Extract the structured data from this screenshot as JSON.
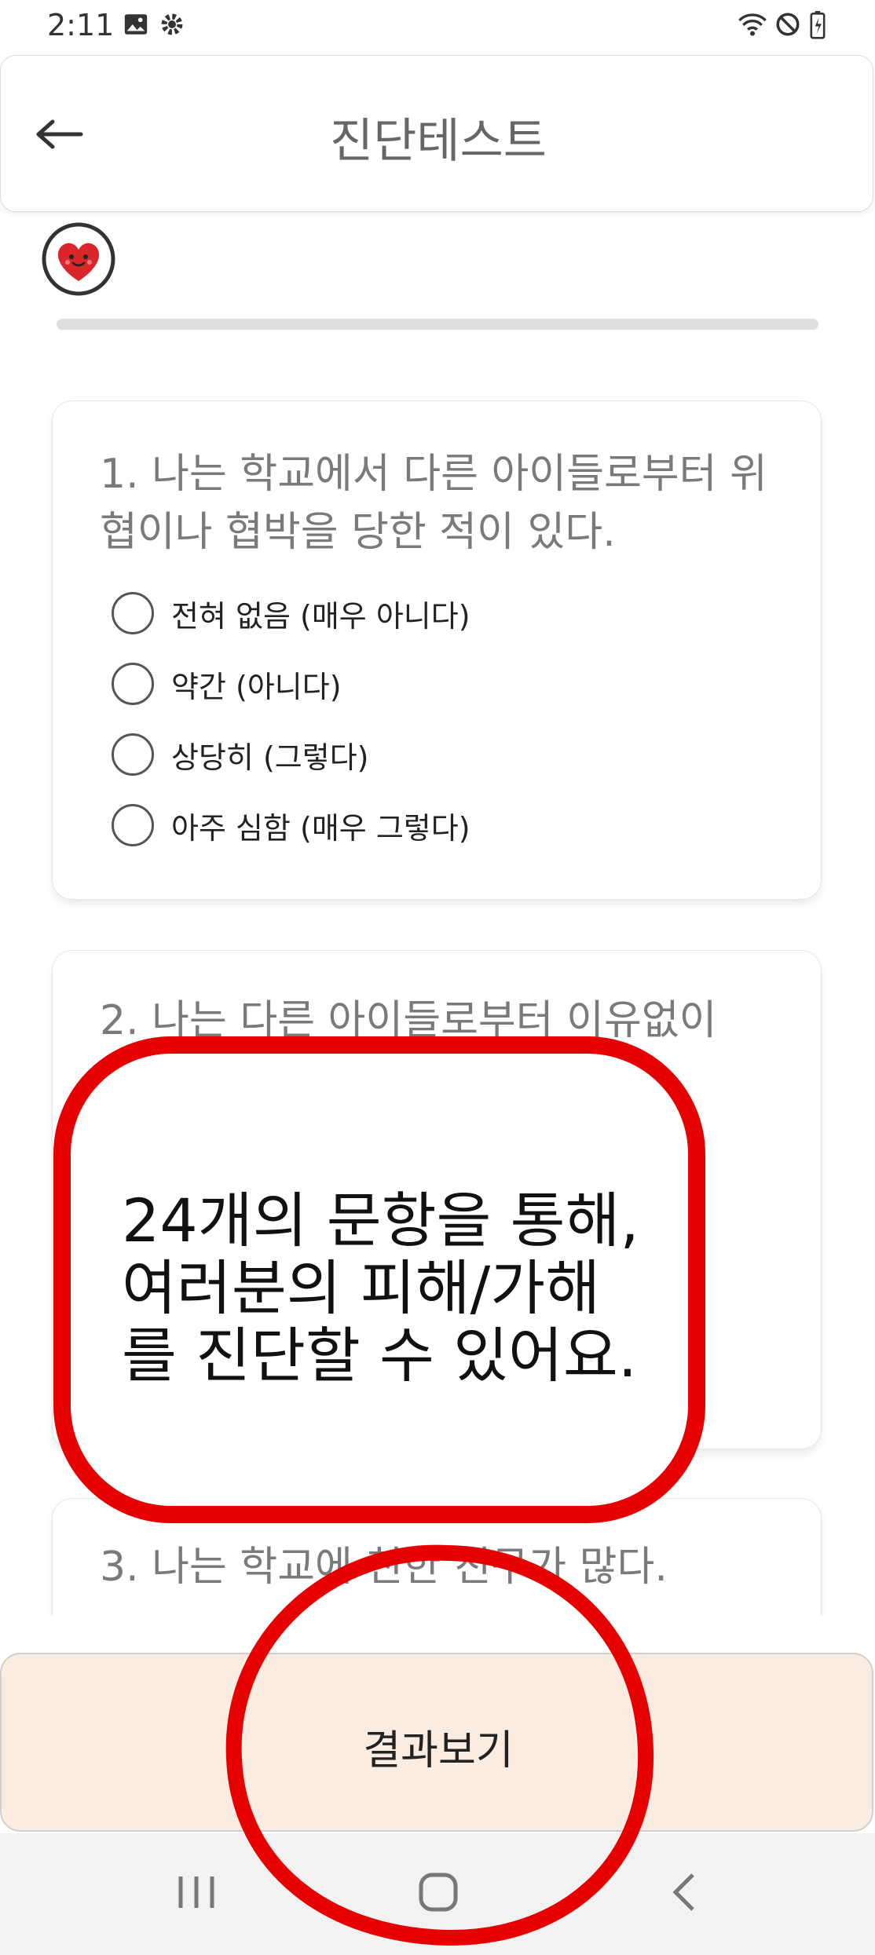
{
  "status": {
    "time": "2:11"
  },
  "header": {
    "title": "진단테스트"
  },
  "questions": [
    {
      "text": "1. 나는 학교에서 다른 아이들로부터 위협이나 협박을 당한 적이 있다.",
      "options": [
        "전혀 없음 (매우 아니다)",
        "약간 (아니다)",
        "상당히 (그렇다)",
        "아주 심함 (매우 그렇다)"
      ]
    },
    {
      "text": "2. 나는 다른 아이들로부터 이유없이"
    },
    {
      "text": "3. 나는 학교에 친한 친구가 많다."
    }
  ],
  "annotation": {
    "lines": [
      "24개의 문항을 통해,",
      "여러분의 피해/가해",
      "를 진단할 수 있어요."
    ]
  },
  "result_button": {
    "label": "결과보기"
  },
  "colors": {
    "accent_red": "#e60000",
    "button_bg": "#fbece1"
  }
}
